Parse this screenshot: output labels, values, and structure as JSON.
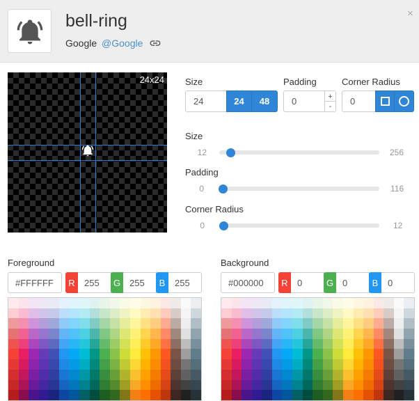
{
  "header": {
    "title": "bell-ring",
    "author": "Google",
    "author_handle": "@Google",
    "icon": "bell-ring-icon",
    "close_label": "×"
  },
  "preview": {
    "size_label": "24x24"
  },
  "controls": {
    "size": {
      "label": "Size",
      "value": "24",
      "preset_small": "24",
      "preset_large": "48"
    },
    "padding": {
      "label": "Padding",
      "value": "0",
      "increment": "+",
      "decrement": "-"
    },
    "corner_radius": {
      "label": "Corner Radius",
      "value": "0",
      "shape_square": "square-icon",
      "shape_circle": "circle-icon"
    }
  },
  "sliders": [
    {
      "label": "Size",
      "min": "12",
      "max": "256",
      "value": 24
    },
    {
      "label": "Padding",
      "min": "0",
      "max": "116",
      "value": 0
    },
    {
      "label": "Corner Radius",
      "min": "0",
      "max": "12",
      "value": 0
    }
  ],
  "foreground": {
    "label": "Foreground",
    "hex": "#FFFFFF",
    "r_label": "R",
    "g_label": "G",
    "b_label": "B",
    "r": "255",
    "g": "255",
    "b": "255"
  },
  "background": {
    "label": "Background",
    "hex": "#000000",
    "r_label": "R",
    "g_label": "G",
    "b_label": "B",
    "r": "0",
    "g": "0",
    "b": "0"
  },
  "colors": {
    "accent": "#2f86d6",
    "red": "#f44336",
    "green": "#4caf50",
    "blue": "#2196f3"
  },
  "palette_columns": [
    [
      "#ffebee",
      "#ffcdd2",
      "#ef9a9a",
      "#e57373",
      "#ef5350",
      "#f44336",
      "#e53935",
      "#d32f2f",
      "#c62828",
      "#b71c1c"
    ],
    [
      "#fce4ec",
      "#f8bbd0",
      "#f48fb1",
      "#f06292",
      "#ec407a",
      "#e91e63",
      "#d81b60",
      "#c2185b",
      "#ad1457",
      "#880e4f"
    ],
    [
      "#f3e5f5",
      "#e1bee7",
      "#ce93d8",
      "#ba68c8",
      "#ab47bc",
      "#9c27b0",
      "#8e24aa",
      "#7b1fa2",
      "#6a1b9a",
      "#4a148c"
    ],
    [
      "#ede7f6",
      "#d1c4e9",
      "#b39ddb",
      "#9575cd",
      "#7e57c2",
      "#673ab7",
      "#5e35b1",
      "#512da8",
      "#4527a0",
      "#311b92"
    ],
    [
      "#e8eaf6",
      "#c5cae9",
      "#9fa8da",
      "#7986cb",
      "#5c6bc0",
      "#3f51b5",
      "#3949ab",
      "#303f9f",
      "#283593",
      "#1a237e"
    ],
    [
      "#e3f2fd",
      "#bbdefb",
      "#90caf9",
      "#64b5f6",
      "#42a5f5",
      "#2196f3",
      "#1e88e5",
      "#1976d2",
      "#1565c0",
      "#0d47a1"
    ],
    [
      "#e1f5fe",
      "#b3e5fc",
      "#81d4fa",
      "#4fc3f7",
      "#29b6f6",
      "#03a9f4",
      "#039be5",
      "#0288d1",
      "#0277bd",
      "#01579b"
    ],
    [
      "#e0f7fa",
      "#b2ebf2",
      "#80deea",
      "#4dd0e1",
      "#26c6da",
      "#00bcd4",
      "#00acc1",
      "#0097a7",
      "#00838f",
      "#006064"
    ],
    [
      "#e0f2f1",
      "#b2dfdb",
      "#80cbc4",
      "#4db6ac",
      "#26a69a",
      "#009688",
      "#00897b",
      "#00796b",
      "#00695c",
      "#004d40"
    ],
    [
      "#e8f5e9",
      "#c8e6c9",
      "#a5d6a7",
      "#81c784",
      "#66bb6a",
      "#4caf50",
      "#43a047",
      "#388e3c",
      "#2e7d32",
      "#1b5e20"
    ],
    [
      "#f1f8e9",
      "#dcedc8",
      "#c5e1a5",
      "#aed581",
      "#9ccc65",
      "#8bc34a",
      "#7cb342",
      "#689f38",
      "#558b2f",
      "#33691e"
    ],
    [
      "#f9fbe7",
      "#f0f4c3",
      "#e6ee9c",
      "#dce775",
      "#d4e157",
      "#cddc39",
      "#c0ca33",
      "#afb42b",
      "#9e9d24",
      "#827717"
    ],
    [
      "#fffde7",
      "#fff9c4",
      "#fff59d",
      "#fff176",
      "#ffee58",
      "#ffeb3b",
      "#fdd835",
      "#fbc02d",
      "#f9a825",
      "#f57f17"
    ],
    [
      "#fff8e1",
      "#ffecb3",
      "#ffe082",
      "#ffd54f",
      "#ffca28",
      "#ffc107",
      "#ffb300",
      "#ffa000",
      "#ff8f00",
      "#ff6f00"
    ],
    [
      "#fff3e0",
      "#ffe0b2",
      "#ffcc80",
      "#ffb74d",
      "#ffa726",
      "#ff9800",
      "#fb8c00",
      "#f57c00",
      "#ef6c00",
      "#e65100"
    ],
    [
      "#fbe9e7",
      "#ffccbc",
      "#ffab91",
      "#ff8a65",
      "#ff7043",
      "#ff5722",
      "#f4511e",
      "#e64a19",
      "#d84315",
      "#bf360c"
    ],
    [
      "#efebe9",
      "#d7ccc8",
      "#bcaaa4",
      "#a1887f",
      "#8d6e63",
      "#795548",
      "#6d4c41",
      "#5d4037",
      "#4e342e",
      "#3e2723"
    ],
    [
      "#fafafa",
      "#f5f5f5",
      "#eeeeee",
      "#e0e0e0",
      "#bdbdbd",
      "#9e9e9e",
      "#757575",
      "#616161",
      "#424242",
      "#212121"
    ],
    [
      "#eceff1",
      "#cfd8dc",
      "#b0bec5",
      "#90a4ae",
      "#78909c",
      "#607d8b",
      "#546e7a",
      "#455a64",
      "#37474f",
      "#263238"
    ]
  ]
}
